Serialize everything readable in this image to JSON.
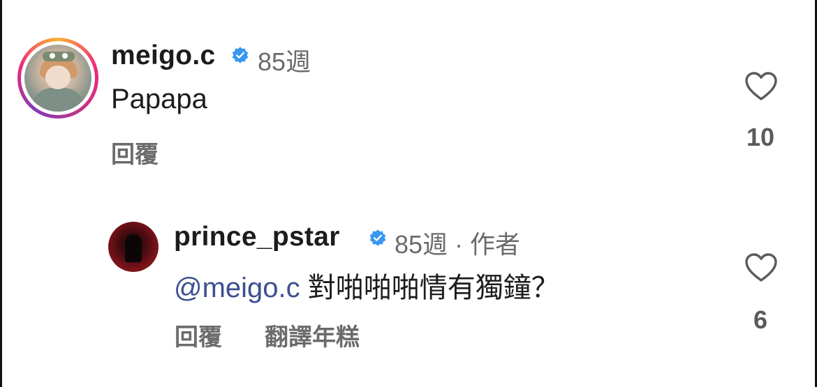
{
  "comments": [
    {
      "username": "meigo.c",
      "verified": true,
      "time": "85週",
      "text": "Papapa",
      "reply_label": "回覆",
      "like_count": "10"
    },
    {
      "username": "prince_pstar",
      "verified": true,
      "time_and_role": "85週 · 作者",
      "mention": "@meigo.c",
      "text": " 對啪啪啪情有獨鐘？",
      "reply_label": "回覆",
      "translate_label": "翻譯年糕",
      "like_count": "6"
    }
  ],
  "colors": {
    "verified_blue": "#3897f0",
    "mention": "#3d4f8f",
    "meta_gray": "#6b6b6b"
  },
  "icons": [
    "verified-badge-icon",
    "heart-icon"
  ]
}
